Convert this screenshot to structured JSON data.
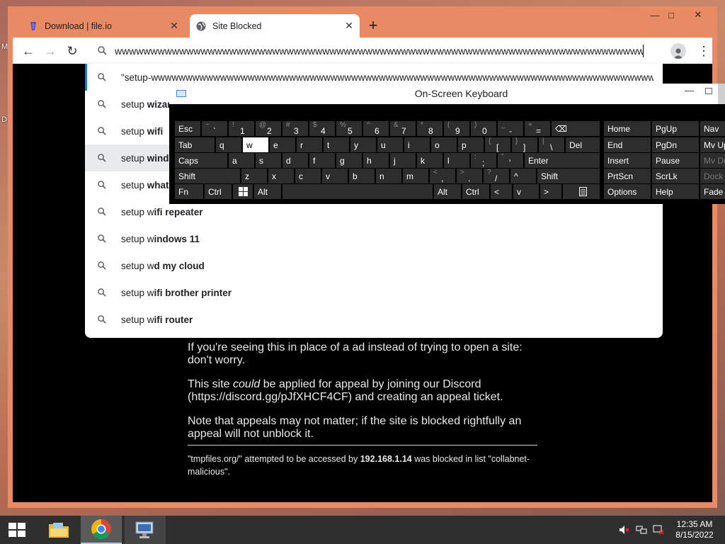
{
  "desktop": {
    "icon_letters": [
      "M",
      "D"
    ]
  },
  "browser": {
    "window_controls": {
      "minimize": "—",
      "maximize": "□",
      "close": "✕"
    },
    "tabs": [
      {
        "title": "Download | file.io",
        "icon": "file-io-icon",
        "active": false
      },
      {
        "title": "Site Blocked",
        "icon": "globe-icon",
        "active": true
      }
    ],
    "new_tab": "+",
    "toolbar": {
      "back": "←",
      "forward": "→",
      "reload": "↻",
      "menu": "⋮",
      "omnibox_value": "wwwwwwwwwwwwwwwwwwwwwwwwwwwwwwwwwwwwwwwwwwwwwwwwwwwwwwwwwwwwwwwwwwwwwwwwwwwwwwwwwwwwwwwwwww"
    },
    "suggestions": [
      {
        "prefix": "\"setup-wwwwwwwwwwwwwwwwwwwwwwwwwwwwwwwwwwwwwwwwwwwwwwwwwwwwwwwwwwwwwwwwwwwwwwwwwwwwwwwwwwwwwww...",
        "bold": ""
      },
      {
        "prefix": "setup ",
        "bold": "wizard"
      },
      {
        "prefix": "setup ",
        "bold": "wifi"
      },
      {
        "prefix": "setup ",
        "bold": "windows"
      },
      {
        "prefix": "setup ",
        "bold": "whatsapp"
      },
      {
        "prefix": "setup w",
        "bold": "ifi repeater"
      },
      {
        "prefix": "setup w",
        "bold": "indows 11"
      },
      {
        "prefix": "setup w",
        "bold": "d my cloud"
      },
      {
        "prefix": "setup w",
        "bold": "ifi brother printer"
      },
      {
        "prefix": "setup w",
        "bold": "ifi router"
      }
    ],
    "page": {
      "para1": "If you're seeing this in place of a ad instead of trying to open a site: don't worry.",
      "para2_before": "This site ",
      "para2_em": "could",
      "para2_after": " be applied for appeal by joining our Discord (https://discord.gg/pJfXHCF4CF) and creating an appeal ticket.",
      "para3": "Note that appeals may not matter; if the site is blocked rightfully an appeal will not unblock it.",
      "footer_site": "\"tmpfiles.org/\"",
      "footer_mid": " attempted to be accessed by ",
      "footer_ip": "192.168.1.14",
      "footer_end": " was blocked in list \"collabnet-malicious\"."
    }
  },
  "osk": {
    "title": "On-Screen Keyboard",
    "rows": [
      [
        {
          "m": "Esc"
        },
        {
          "s": "~",
          "b": "`"
        },
        {
          "s": "!",
          "b": "1"
        },
        {
          "s": "@",
          "b": "2"
        },
        {
          "s": "#",
          "b": "3"
        },
        {
          "s": "$",
          "b": "4"
        },
        {
          "s": "%",
          "b": "5"
        },
        {
          "s": "^",
          "b": "6"
        },
        {
          "s": "&",
          "b": "7"
        },
        {
          "s": "*",
          "b": "8"
        },
        {
          "s": "(",
          "b": "9"
        },
        {
          "s": ")",
          "b": "0"
        },
        {
          "s": "_",
          "b": "-"
        },
        {
          "s": "+",
          "b": "="
        },
        {
          "m": "⌫"
        }
      ],
      [
        {
          "m": "Tab"
        },
        {
          "m": "q"
        },
        {
          "m": "w",
          "pressed": true
        },
        {
          "m": "e"
        },
        {
          "m": "r"
        },
        {
          "m": "t"
        },
        {
          "m": "y"
        },
        {
          "m": "u"
        },
        {
          "m": "i"
        },
        {
          "m": "o"
        },
        {
          "m": "p"
        },
        {
          "s": "{",
          "b": "["
        },
        {
          "s": "}",
          "b": "]"
        },
        {
          "s": "|",
          "b": "\\"
        },
        {
          "m": "Del"
        }
      ],
      [
        {
          "m": "Caps"
        },
        {
          "m": "a"
        },
        {
          "m": "s"
        },
        {
          "m": "d"
        },
        {
          "m": "f"
        },
        {
          "m": "g"
        },
        {
          "m": "h"
        },
        {
          "m": "j"
        },
        {
          "m": "k"
        },
        {
          "m": "l"
        },
        {
          "s": ":",
          "b": ";"
        },
        {
          "s": "\"",
          "b": "'"
        },
        {
          "m": "Enter"
        }
      ],
      [
        {
          "m": "Shift"
        },
        {
          "m": "z"
        },
        {
          "m": "x"
        },
        {
          "m": "c"
        },
        {
          "m": "v"
        },
        {
          "m": "b"
        },
        {
          "m": "n"
        },
        {
          "m": "m"
        },
        {
          "s": "<",
          "b": ","
        },
        {
          "s": ">",
          "b": "."
        },
        {
          "s": "?",
          "b": "/"
        },
        {
          "m": "^"
        },
        {
          "m": "Shift"
        }
      ],
      [
        {
          "m": "Fn"
        },
        {
          "m": "Ctrl"
        },
        {
          "m": "windows-logo-icon",
          "icon": true
        },
        {
          "m": "Alt"
        },
        {
          "m": ""
        },
        {
          "m": "Alt"
        },
        {
          "m": "Ctrl"
        },
        {
          "m": "<"
        },
        {
          "m": "v"
        },
        {
          "m": ">"
        },
        {
          "m": "menu-icon",
          "icon": true
        }
      ]
    ],
    "nav": [
      [
        {
          "m": "Home"
        },
        {
          "m": "PgUp"
        },
        {
          "m": "Nav"
        }
      ],
      [
        {
          "m": "End"
        },
        {
          "m": "PgDn"
        },
        {
          "m": "Mv Up"
        }
      ],
      [
        {
          "m": "Insert"
        },
        {
          "m": "Pause"
        },
        {
          "m": "Mv Dn",
          "dim": true
        }
      ],
      [
        {
          "m": "PrtScn"
        },
        {
          "m": "ScrLk"
        },
        {
          "m": "Dock",
          "dim": true
        }
      ],
      [
        {
          "m": "Options"
        },
        {
          "m": "Help"
        },
        {
          "m": "Fade"
        }
      ]
    ]
  },
  "taskbar": {
    "apps": [
      "start-icon",
      "file-explorer-icon",
      "chrome-icon",
      "remote-desktop-icon"
    ],
    "active_app": "chrome-icon",
    "tray": [
      "volume-muted-icon",
      "network-icon",
      "action-center-icon"
    ],
    "time": "12:35 AM",
    "date": "8/15/2022"
  },
  "colors": {
    "window_frame": "#e88a63",
    "page_bg": "#000000",
    "osk_key": "#2d2d2d",
    "suggestion_highlight": "#e8eaed"
  }
}
